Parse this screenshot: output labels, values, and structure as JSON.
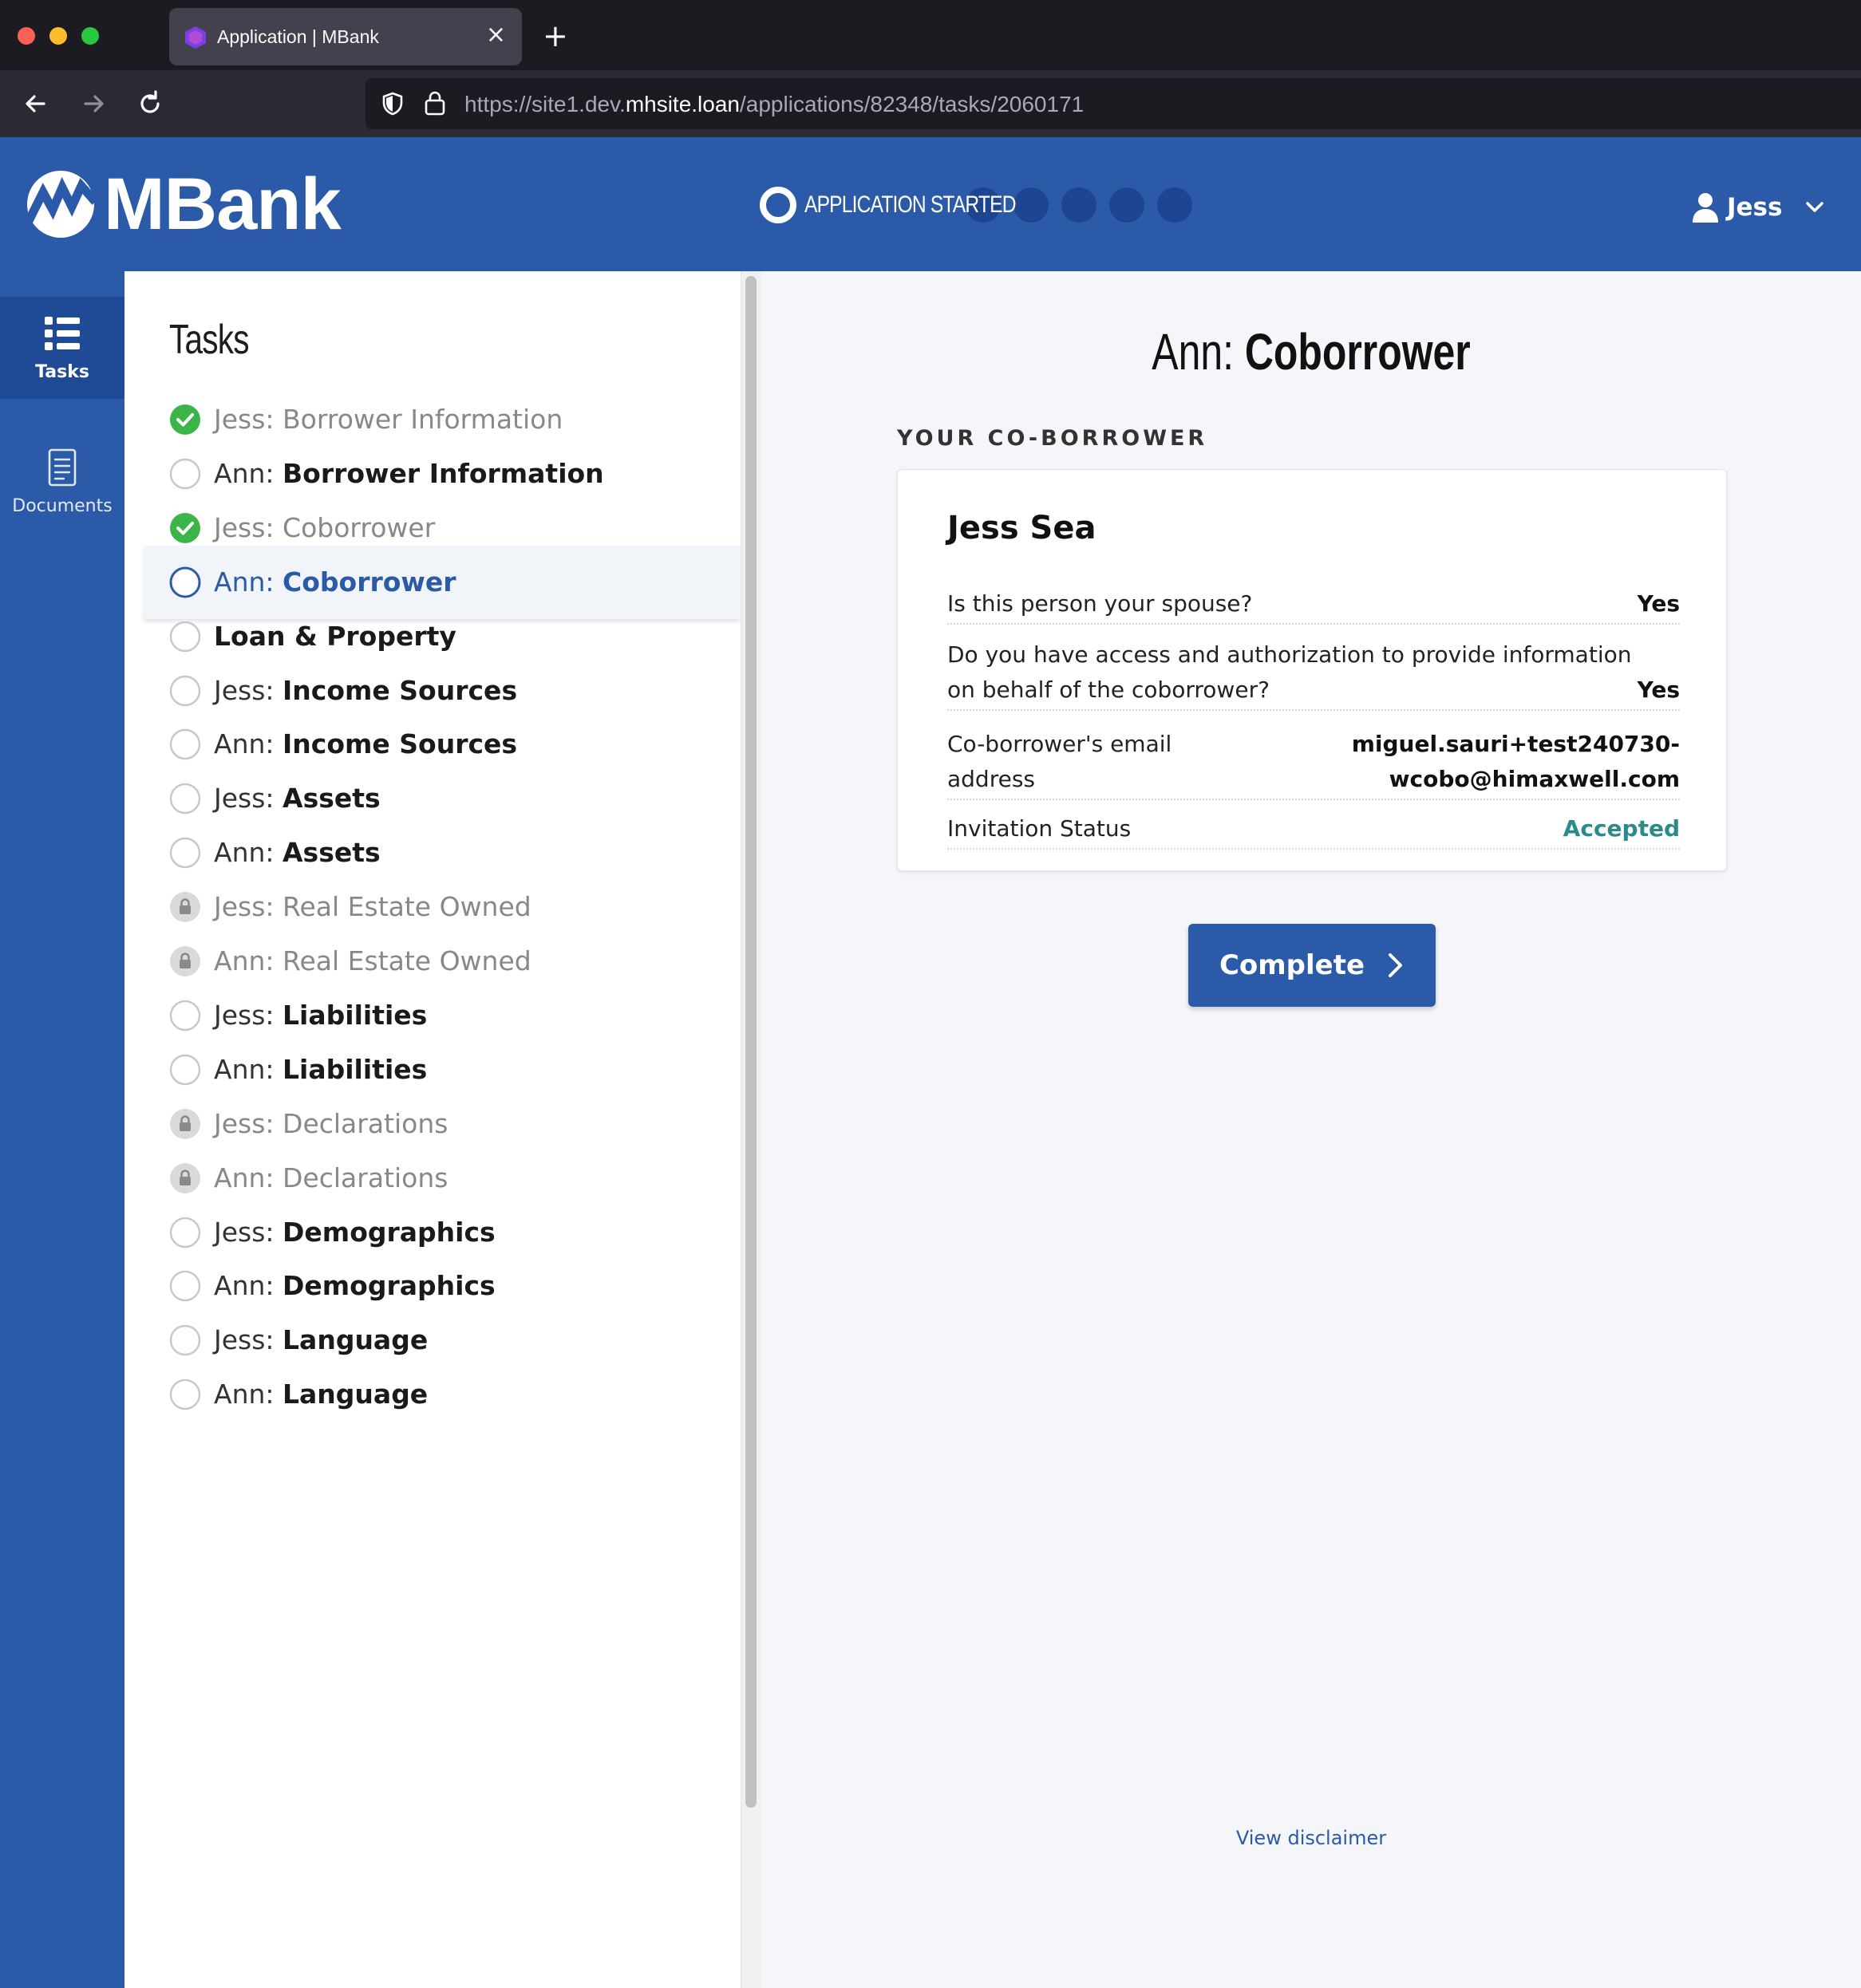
{
  "browser": {
    "tab_title": "Application | MBank",
    "tab_close": "×",
    "new_tab": "+",
    "url_prefix": "https://site1.dev.",
    "url_host": "mhsite.loan",
    "url_path": "/applications/82348/tasks/2060171"
  },
  "header": {
    "brand": "MBank",
    "progress_label": "APPLICATION STARTED",
    "progress_total_steps": 6,
    "progress_current_step": 1,
    "user_name": "Jess",
    "brand_color": "#2b5aa8"
  },
  "rail": {
    "tasks_label": "Tasks",
    "documents_label": "Documents"
  },
  "tasks": {
    "heading": "Tasks",
    "items": [
      {
        "owner": "Jess:",
        "name": "Borrower Information",
        "status": "done"
      },
      {
        "owner": "Ann:",
        "name": "Borrower Information",
        "status": "todo"
      },
      {
        "owner": "Jess:",
        "name": "Coborrower",
        "status": "done"
      },
      {
        "owner": "Ann:",
        "name": "Coborrower",
        "status": "active"
      },
      {
        "owner": "",
        "name": "Loan & Property",
        "status": "todo"
      },
      {
        "owner": "Jess:",
        "name": "Income Sources",
        "status": "todo"
      },
      {
        "owner": "Ann:",
        "name": "Income Sources",
        "status": "todo"
      },
      {
        "owner": "Jess:",
        "name": "Assets",
        "status": "todo"
      },
      {
        "owner": "Ann:",
        "name": "Assets",
        "status": "todo"
      },
      {
        "owner": "Jess:",
        "name": "Real Estate Owned",
        "status": "locked"
      },
      {
        "owner": "Ann:",
        "name": "Real Estate Owned",
        "status": "locked"
      },
      {
        "owner": "Jess:",
        "name": "Liabilities",
        "status": "todo"
      },
      {
        "owner": "Ann:",
        "name": "Liabilities",
        "status": "todo"
      },
      {
        "owner": "Jess:",
        "name": "Declarations",
        "status": "locked"
      },
      {
        "owner": "Ann:",
        "name": "Declarations",
        "status": "locked"
      },
      {
        "owner": "Jess:",
        "name": "Demographics",
        "status": "todo"
      },
      {
        "owner": "Ann:",
        "name": "Demographics",
        "status": "todo"
      },
      {
        "owner": "Jess:",
        "name": "Language",
        "status": "todo"
      },
      {
        "owner": "Ann:",
        "name": "Language",
        "status": "todo"
      }
    ]
  },
  "main": {
    "title_owner": "Ann:",
    "title_name": "Coborrower",
    "section_label": "YOUR CO-BORROWER",
    "card": {
      "name": "Jess Sea",
      "rows": [
        {
          "label": "Is this person your spouse?",
          "value": "Yes"
        },
        {
          "label_line1": "Do you have access and authorization to provide information",
          "label_line2": "on behalf of the coborrower?",
          "value": "Yes"
        },
        {
          "label_line1": "Co-borrower's email",
          "label_line2": "address",
          "value_line1": "miguel.sauri+test240730-",
          "value_line2": "wcobo@himaxwell.com"
        },
        {
          "label": "Invitation Status",
          "value": "Accepted"
        }
      ]
    },
    "complete_label": "Complete",
    "disclaimer": "View disclaimer"
  }
}
